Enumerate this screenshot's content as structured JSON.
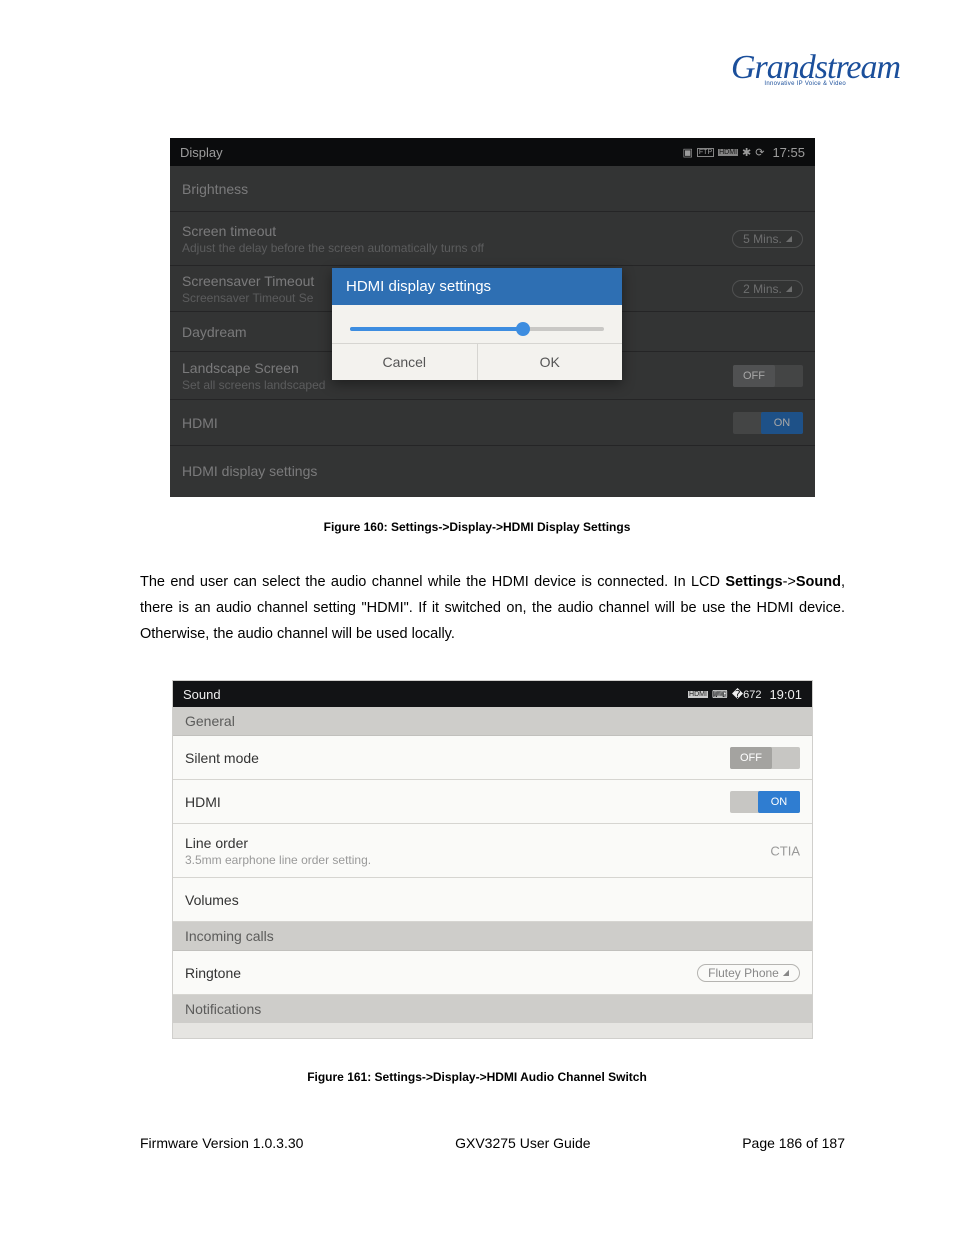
{
  "logo": {
    "brand": "Grandstream",
    "tagline": "Innovative IP Voice & Video"
  },
  "display": {
    "title": "Display",
    "time": "17:55",
    "rows": {
      "brightness": "Brightness",
      "screen_timeout": {
        "title": "Screen timeout",
        "sub": "Adjust the delay before the screen automatically turns off",
        "value": "5 Mins."
      },
      "screensaver_timeout": {
        "title": "Screensaver Timeout",
        "sub": "Screensaver Timeout Se",
        "value": "2 Mins."
      },
      "daydream": "Daydream",
      "landscape": {
        "title": "Landscape Screen",
        "sub": "Set all screens landscaped",
        "value": "OFF"
      },
      "hdmi": {
        "title": "HDMI",
        "value": "ON"
      },
      "hdmi_disp": "HDMI display settings"
    },
    "dialog": {
      "title": "HDMI display settings",
      "cancel": "Cancel",
      "ok": "OK"
    },
    "caption": "Figure 160: Settings->Display->HDMI Display Settings"
  },
  "paragraph": {
    "prefix": "The end user can select the audio channel while the HDMI device is connected. In LCD ",
    "settings": "Settings",
    "arrow": "->",
    "sound": "Sound",
    "rest": ", there is an audio channel setting \"HDMI\". If it switched on, the audio channel will be use the HDMI device. Otherwise, the audio channel will be used locally."
  },
  "sound": {
    "title": "Sound",
    "time": "19:01",
    "sections": {
      "general": "General",
      "incoming": "Incoming calls",
      "notifications": "Notifications"
    },
    "rows": {
      "silent": {
        "title": "Silent mode",
        "value": "OFF"
      },
      "hdmi": {
        "title": "HDMI",
        "value": "ON"
      },
      "lineorder": {
        "title": "Line order",
        "sub": "3.5mm earphone line order setting.",
        "value": "CTIA"
      },
      "volumes": "Volumes",
      "ringtone": {
        "title": "Ringtone",
        "value": "Flutey Phone"
      }
    },
    "caption": "Figure 161: Settings->Display->HDMI Audio Channel Switch"
  },
  "footer": {
    "left": "Firmware Version 1.0.3.30",
    "center": "GXV3275 User Guide",
    "right": "Page 186 of 187"
  }
}
